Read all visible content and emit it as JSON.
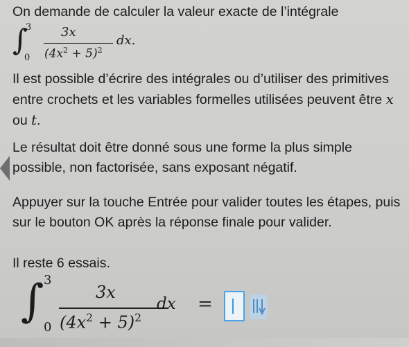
{
  "question": {
    "line1": "On demande de calculer la valeur exacte de l’intégrale",
    "integral": {
      "sign": "∫",
      "upper": "3",
      "lower": "0",
      "numerator": "3x",
      "denominator_base": "(4x",
      "denominator_exp_inner": "2",
      "denominator_tail": " + 5)",
      "denominator_exp_outer": "2",
      "dx": "dx."
    },
    "para2_a": "Il est possible d’écrire des intégrales ou d’utiliser des primitives entre crochets et les variables formelles utilisées peuvent être ",
    "var_x": "x",
    "para2_or": " ou ",
    "var_t": "t",
    "para2_end": ".",
    "para3": "Le résultat doit être donné sous une forme la plus simple possible, non factorisée, sans exposant négatif.",
    "para4": "Appuyer sur la touche Entrée pour valider toutes les étapes, puis sur le bouton OK après la réponse finale pour valider.",
    "attempts": "Il reste 6 essais."
  },
  "answer_line": {
    "upper": "3",
    "lower": "0",
    "numerator": "3x",
    "denominator_base": "(4x",
    "denominator_exp_inner": "2",
    "denominator_tail": " + 5)",
    "denominator_exp_outer": "2",
    "dx": "dx",
    "equals": "=",
    "input_value": ""
  },
  "icons": {
    "keyboard": "math-keyboard-icon",
    "nav": "previous-arrow-icon"
  },
  "colors": {
    "background": "#cfcfcd",
    "input_border": "#4aa3e6",
    "text": "#1c1c1c"
  }
}
